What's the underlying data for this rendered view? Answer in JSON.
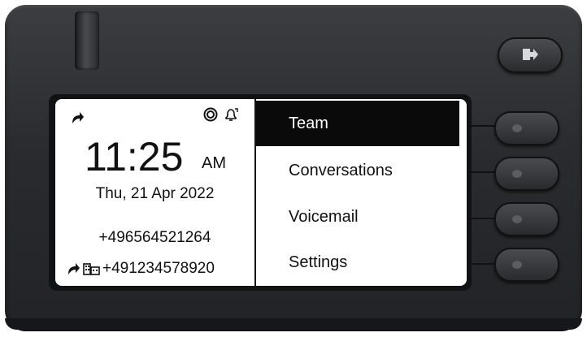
{
  "status": {
    "forward_icon": "call-forward-icon",
    "ring_icon": "ring-off-icon",
    "bell_icon": "bell-icon"
  },
  "clock": {
    "time": "11:25",
    "ampm": "AM",
    "date": "Thu, 21 Apr 2022"
  },
  "own_number": "+496564521264",
  "forward_target": {
    "icon": "call-forward-icon",
    "type_icon": "office-phone-icon",
    "number": "+491234578920"
  },
  "menu": {
    "items": [
      {
        "label": "Team",
        "selected": true
      },
      {
        "label": "Conversations",
        "selected": false
      },
      {
        "label": "Voicemail",
        "selected": false
      },
      {
        "label": "Settings",
        "selected": false
      }
    ]
  },
  "buttons": {
    "logout_icon": "logout-icon"
  }
}
